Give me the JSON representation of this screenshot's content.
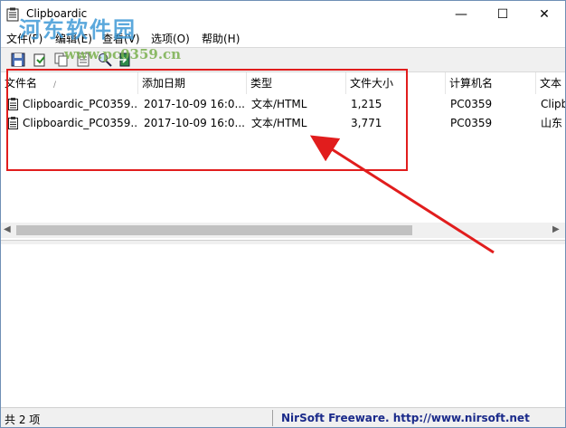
{
  "window": {
    "title": "Clipboardic",
    "controls": {
      "minimize": "—",
      "maximize": "☐",
      "close": "✕"
    }
  },
  "menu": {
    "items": [
      {
        "label": "文件(F)"
      },
      {
        "label": "编辑(E)"
      },
      {
        "label": "查看(V)"
      },
      {
        "label": "选项(O)"
      },
      {
        "label": "帮助(H)"
      }
    ]
  },
  "toolbar": {
    "buttons": [
      {
        "icon": "save-icon"
      },
      {
        "icon": "copy-to-clipboard-icon"
      },
      {
        "icon": "copy-icon"
      },
      {
        "icon": "properties-icon"
      },
      {
        "icon": "find-icon"
      },
      {
        "icon": "exit-icon"
      }
    ]
  },
  "list": {
    "columns": [
      {
        "label": "文件名"
      },
      {
        "label": "添加日期"
      },
      {
        "label": "类型"
      },
      {
        "label": "文件大小"
      },
      {
        "label": "计算机名"
      },
      {
        "label": "文本"
      }
    ],
    "rows": [
      {
        "file": "Clipboardic_PC0359...",
        "date": "2017-10-09 16:0...",
        "type": "文本/HTML",
        "size": "1,215",
        "computer": "PC0359",
        "text": "Clipb"
      },
      {
        "file": "Clipboardic_PC0359...",
        "date": "2017-10-09 16:0...",
        "type": "文本/HTML",
        "size": "3,771",
        "computer": "PC0359",
        "text": "山东"
      }
    ]
  },
  "status": {
    "count": "共 2 项",
    "credit": "NirSoft Freeware.  http://www.nirsoft.net"
  },
  "watermark": {
    "text": "河东软件园",
    "url": "www.pc0359.cn"
  },
  "colors": {
    "annotation": "#e11d1d",
    "credit": "#1a2a8a"
  }
}
